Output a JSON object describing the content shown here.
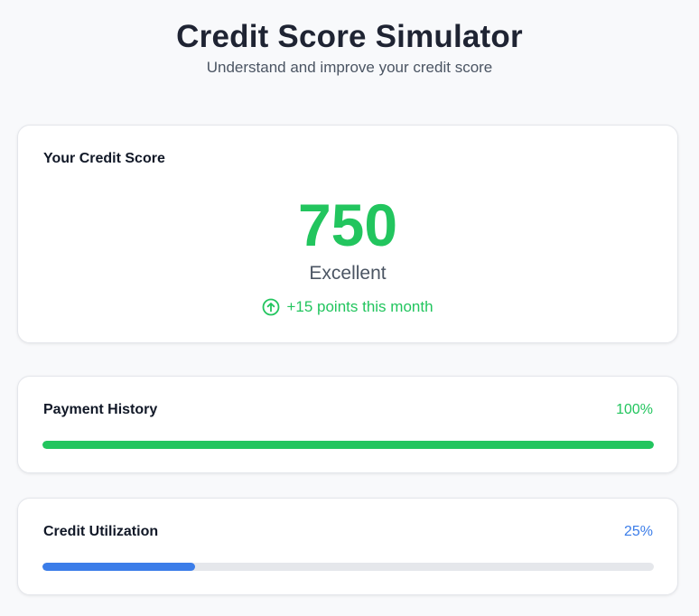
{
  "header": {
    "title": "Credit Score Simulator",
    "subtitle": "Understand and improve your credit score"
  },
  "score": {
    "label": "Your Credit Score",
    "value": "750",
    "rating": "Excellent",
    "change": "+15 points this month",
    "change_icon": "arrow-up-circle-icon",
    "color": "#22c55e"
  },
  "factors": [
    {
      "label": "Payment History",
      "percent_text": "100%",
      "value": 100,
      "color": "#22c55e"
    },
    {
      "label": "Credit Utilization",
      "percent_text": "25%",
      "value": 25,
      "color": "#3b7de9"
    }
  ]
}
